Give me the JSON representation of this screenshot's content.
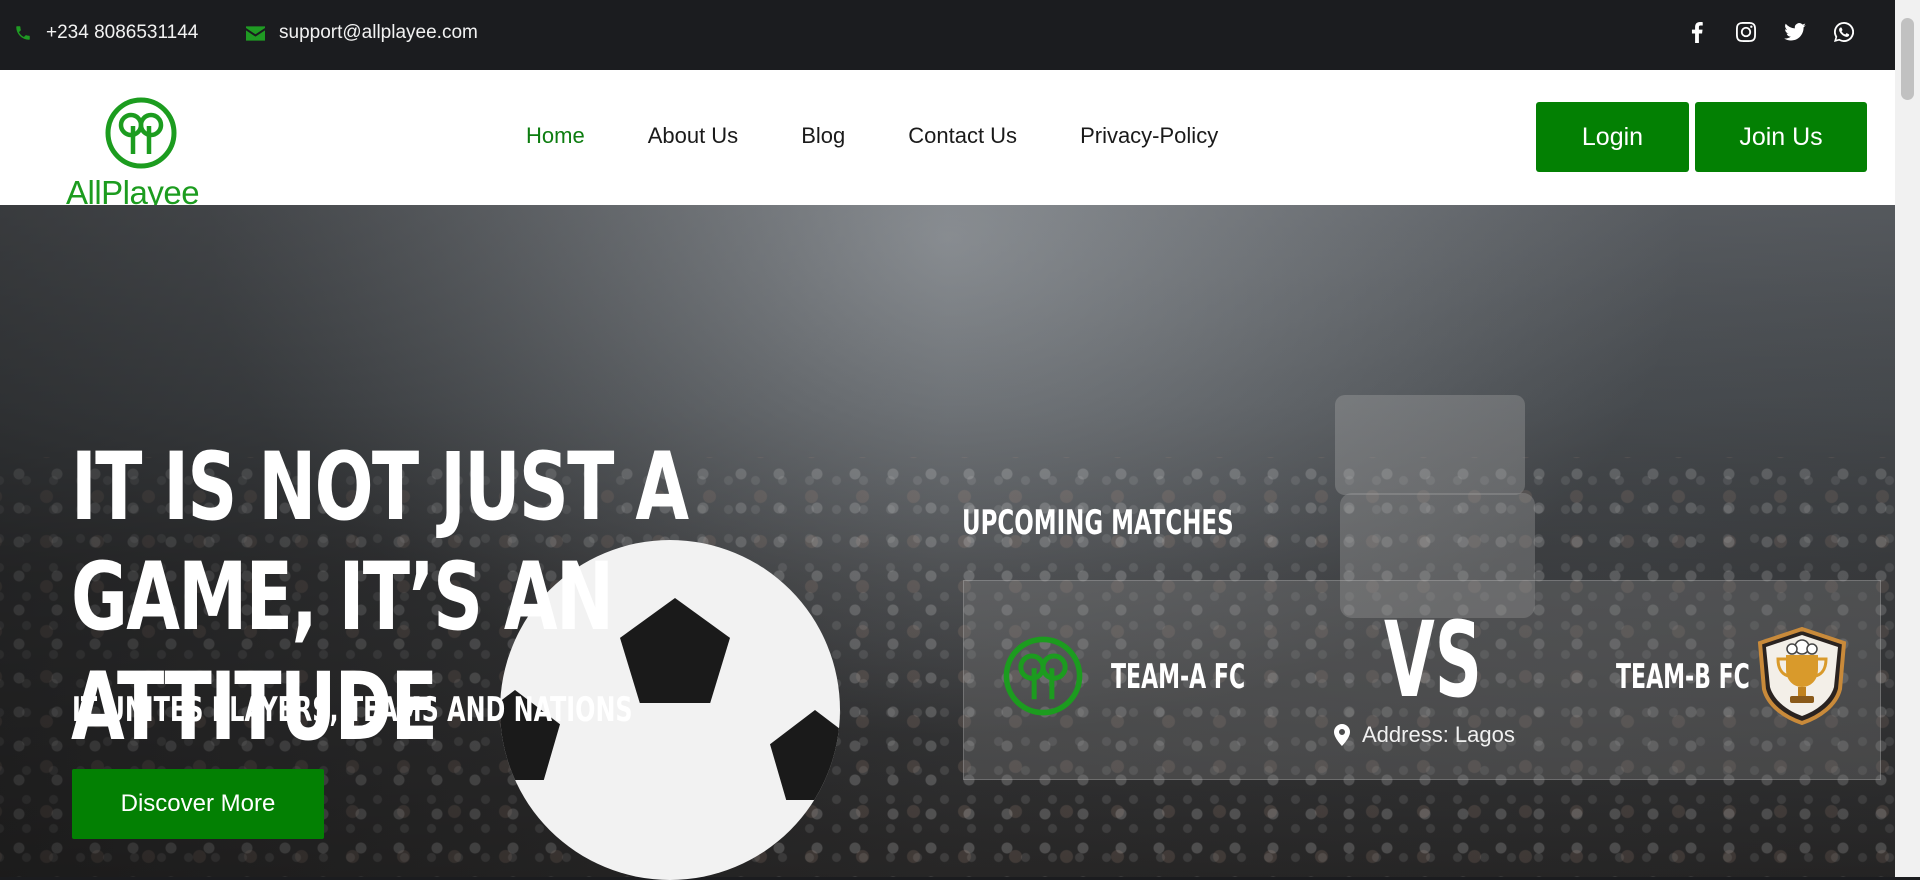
{
  "topbar": {
    "phone": "+234 8086531144",
    "email": "support@allplayee.com",
    "social": [
      "facebook-icon",
      "instagram-icon",
      "twitter-icon",
      "whatsapp-icon"
    ]
  },
  "header": {
    "brand": "AllPlayee",
    "nav": [
      "Home",
      "About Us",
      "Blog",
      "Contact Us",
      "Privacy-Policy"
    ],
    "active_nav": "Home",
    "login_label": "Login",
    "join_label": "Join Us"
  },
  "hero": {
    "headline": "IT IS NOT JUST A GAME, IT’S AN ATTITUDE",
    "subline": "IT UNITES PLAYERS, TEAMS AND NATIONS",
    "cta_label": "Discover More"
  },
  "matches": {
    "title": "UPCOMING MATCHES",
    "team_a": "TEAM-A FC",
    "vs": "VS",
    "team_b": "TEAM-B FC",
    "address": "Address: Lagos"
  },
  "colors": {
    "brand_green": "#038003",
    "logo_green": "#1c9c1f",
    "dark_bar": "#1b1c1f"
  }
}
